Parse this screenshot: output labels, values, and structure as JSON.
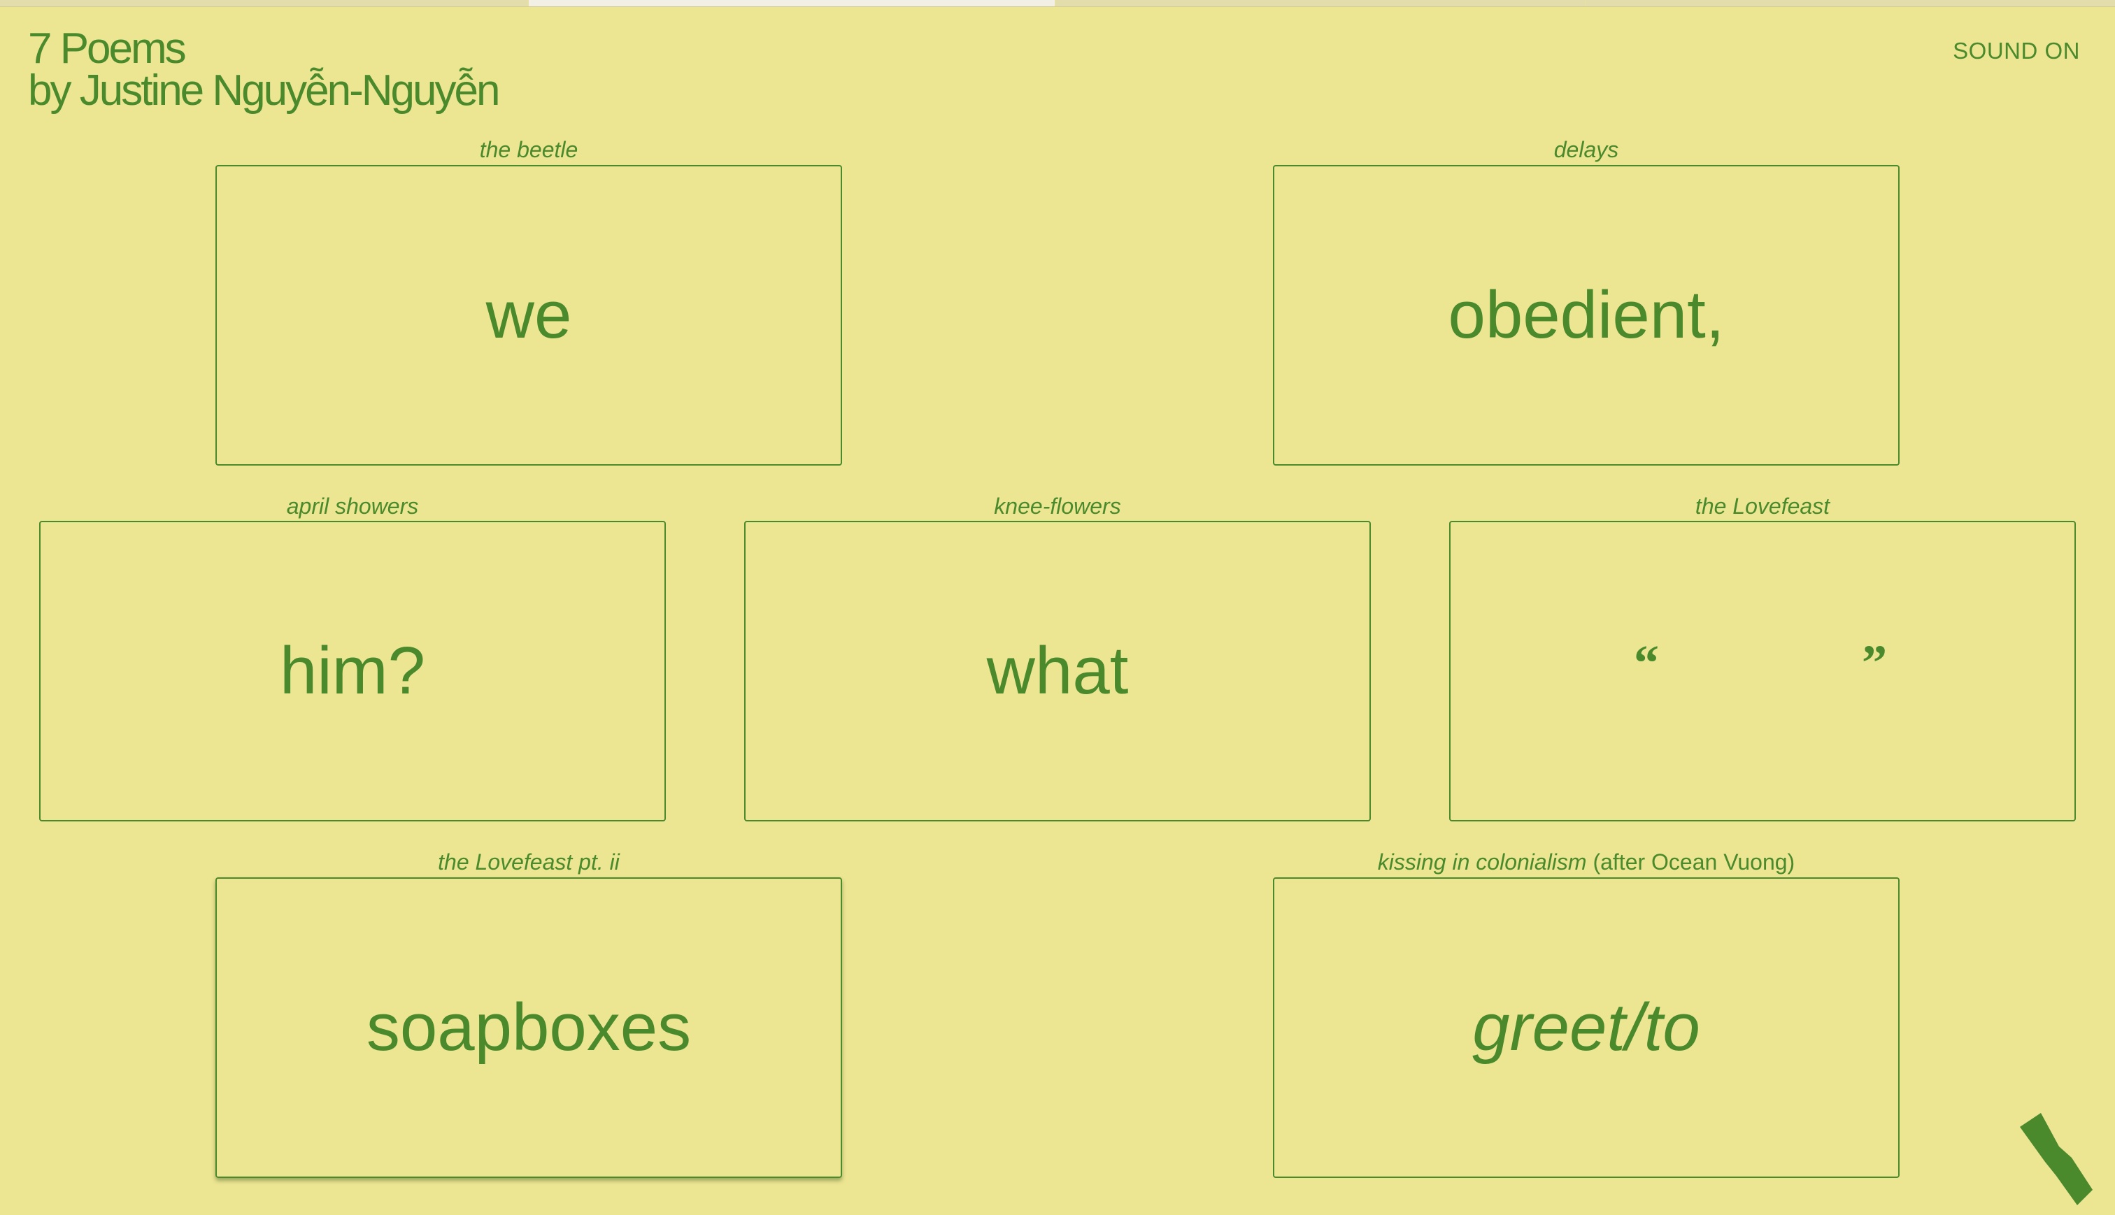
{
  "header": {
    "title_line1": "7 Poems",
    "title_line2": "by Justine Nguyễn-Nguyễn",
    "sound_toggle": "SOUND ON"
  },
  "poems": [
    {
      "title": "the beetle",
      "word": "we"
    },
    {
      "title": "delays",
      "word": "obedient,"
    },
    {
      "title": "april showers",
      "word": "him?"
    },
    {
      "title": "knee-flowers",
      "word": "what"
    },
    {
      "title": "the Lovefeast",
      "word_open_quote": "“",
      "word_close_quote": "”"
    },
    {
      "title": "the Lovefeast pt. ii",
      "word": "soapboxes"
    },
    {
      "title": "kissing in colonialism",
      "title_suffix": "(after Ocean Vuong)",
      "word": "greet/to"
    }
  ],
  "colors": {
    "background": "#ece592",
    "accent_green": "#4a8a2c"
  },
  "icons": {
    "corner": "ribbon-icon"
  }
}
